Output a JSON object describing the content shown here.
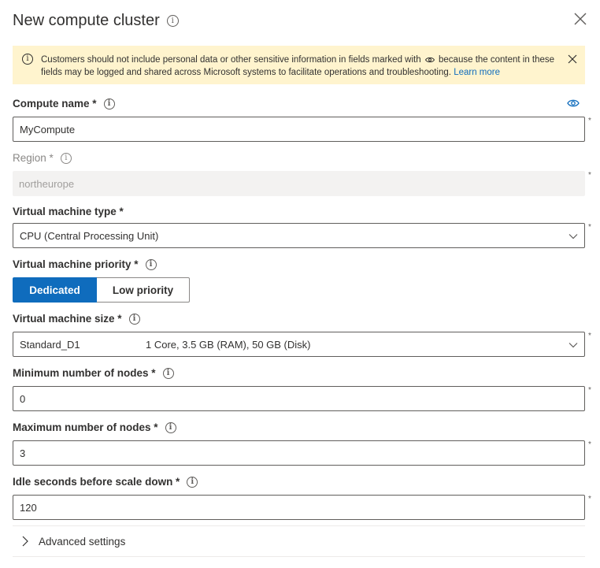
{
  "panel": {
    "title": "New compute cluster",
    "info_glyph": "i"
  },
  "warning": {
    "text_before_eye": "Customers should not include personal data or other sensitive information in fields marked with",
    "text_after_eye": "because the content in these fields may be logged and shared across Microsoft systems to facilitate operations and troubleshooting.",
    "link_label": "Learn more",
    "background_color": "#fff4ce"
  },
  "fields": {
    "compute_name": {
      "label": "Compute name *",
      "value": "MyCompute"
    },
    "region": {
      "label": "Region *",
      "value": "northeurope"
    },
    "vm_type": {
      "label": "Virtual machine type *",
      "value": "CPU (Central Processing Unit)"
    },
    "vm_priority": {
      "label": "Virtual machine priority *",
      "options": [
        "Dedicated",
        "Low priority"
      ],
      "selected": "Dedicated"
    },
    "vm_size": {
      "label": "Virtual machine size *",
      "value_name": "Standard_D1",
      "value_spec": "1 Core, 3.5 GB (RAM), 50 GB (Disk)"
    },
    "min_nodes": {
      "label": "Minimum number of nodes *",
      "value": "0"
    },
    "max_nodes": {
      "label": "Maximum number of nodes *",
      "value": "3"
    },
    "idle_seconds": {
      "label": "Idle seconds before scale down *",
      "value": "120"
    }
  },
  "required_marker": "*",
  "advanced": {
    "label": "Advanced settings"
  },
  "colors": {
    "accent": "#0f6cbd",
    "text": "#323130",
    "readonly_bg": "#f3f2f1"
  },
  "icons": [
    "info-icon",
    "close-icon",
    "eye-icon",
    "chevron-down-icon",
    "chevron-right-icon"
  ]
}
